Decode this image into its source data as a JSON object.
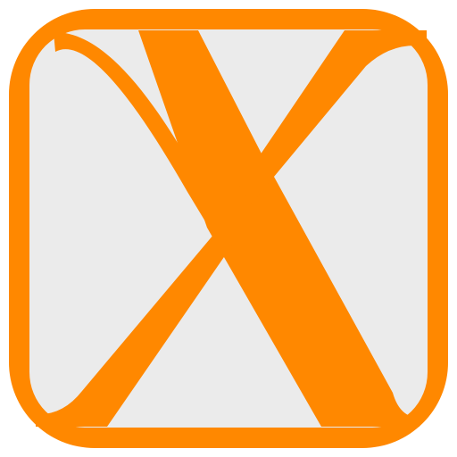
{
  "app_icon": {
    "icon_name": "x-logo-icon",
    "colors": {
      "background": "#ffffff",
      "frame": "#ff8800",
      "inner": "#ebebeb",
      "glyph": "#ff8800"
    }
  }
}
